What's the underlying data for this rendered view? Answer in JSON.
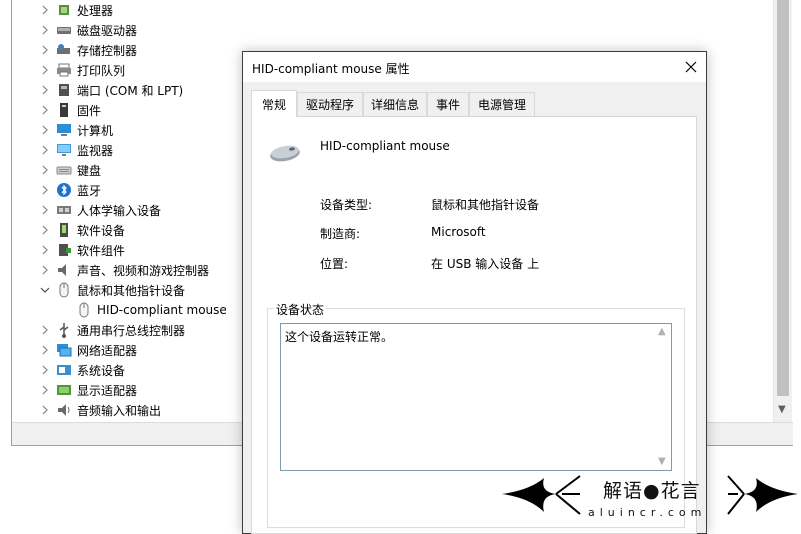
{
  "tree": {
    "items": [
      {
        "label": "处理器",
        "icon": "processor-icon",
        "expanded": false
      },
      {
        "label": "磁盘驱动器",
        "icon": "disk-drive-icon",
        "expanded": false
      },
      {
        "label": "存储控制器",
        "icon": "storage-controller-icon",
        "expanded": false
      },
      {
        "label": "打印队列",
        "icon": "printer-icon",
        "expanded": false
      },
      {
        "label": "端口 (COM 和 LPT)",
        "icon": "port-icon",
        "expanded": false
      },
      {
        "label": "固件",
        "icon": "firmware-icon",
        "expanded": false
      },
      {
        "label": "计算机",
        "icon": "computer-icon",
        "expanded": false
      },
      {
        "label": "监视器",
        "icon": "monitor-icon",
        "expanded": false
      },
      {
        "label": "键盘",
        "icon": "keyboard-icon",
        "expanded": false
      },
      {
        "label": "蓝牙",
        "icon": "bluetooth-icon",
        "expanded": false
      },
      {
        "label": "人体学输入设备",
        "icon": "hid-icon",
        "expanded": false
      },
      {
        "label": "软件设备",
        "icon": "software-device-icon",
        "expanded": false
      },
      {
        "label": "软件组件",
        "icon": "software-component-icon",
        "expanded": false
      },
      {
        "label": "声音、视频和游戏控制器",
        "icon": "sound-icon",
        "expanded": false
      },
      {
        "label": "鼠标和其他指针设备",
        "icon": "mouse-icon",
        "expanded": true
      },
      {
        "label": "HID-compliant mouse",
        "icon": "mouse-icon",
        "child": true
      },
      {
        "label": "通用串行总线控制器",
        "icon": "usb-icon",
        "expanded": false
      },
      {
        "label": "网络适配器",
        "icon": "network-adapter-icon",
        "expanded": false
      },
      {
        "label": "系统设备",
        "icon": "system-device-icon",
        "expanded": false
      },
      {
        "label": "显示适配器",
        "icon": "display-adapter-icon",
        "expanded": false
      },
      {
        "label": "音频输入和输出",
        "icon": "audio-io-icon",
        "expanded": false
      }
    ]
  },
  "dialog": {
    "title": "HID-compliant mouse 属性",
    "tabs": [
      "常规",
      "驱动程序",
      "详细信息",
      "事件",
      "电源管理"
    ],
    "active_tab": "常规",
    "device_name": "HID-compliant mouse",
    "properties": [
      {
        "label": "设备类型:",
        "value": "鼠标和其他指针设备"
      },
      {
        "label": "制造商:",
        "value": "Microsoft"
      },
      {
        "label": "位置:",
        "value": "在 USB 输入设备 上"
      }
    ],
    "status_legend": "设备状态",
    "status_text": "这个设备运转正常。"
  },
  "watermark": {
    "text": "解语●花言",
    "url": "aluincr.com"
  },
  "colors": {
    "accent_blue": "#0078d7",
    "titlebar_bg": "#ffffff",
    "dialog_bg": "#f0f0f0"
  }
}
